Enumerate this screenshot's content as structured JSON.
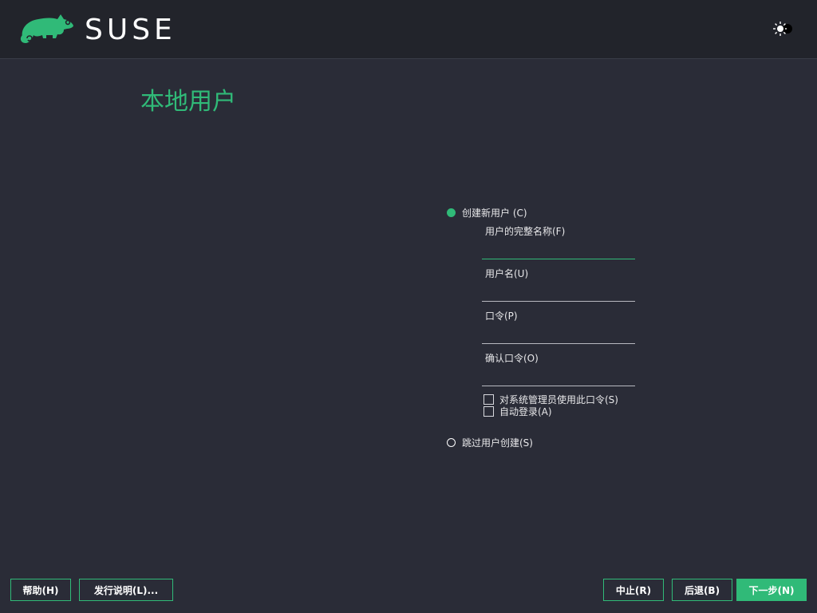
{
  "header": {
    "brand": "SUSE",
    "theme_toggle_icon": "sun-moon-icon"
  },
  "page": {
    "title": "本地用户"
  },
  "form": {
    "create_user": {
      "label": "创建新用户 (C)",
      "checked": true
    },
    "full_name": {
      "label": "用户的完整名称(F)",
      "value": ""
    },
    "username": {
      "label": "用户名(U)",
      "value": ""
    },
    "password": {
      "label": "口令(P)",
      "value": ""
    },
    "confirm_password": {
      "label": "确认口令(O)",
      "value": ""
    },
    "use_for_admin": {
      "label": "对系统管理员使用此口令(S)",
      "checked": false
    },
    "auto_login": {
      "label": "自动登录(A)",
      "checked": false
    },
    "skip_user": {
      "label": "跳过用户创建(S)",
      "checked": false
    }
  },
  "footer": {
    "help": "帮助(H)",
    "release_notes": "发行说明(L)...",
    "abort": "中止(R)",
    "back": "后退(B)",
    "next": "下一步(N)"
  },
  "colors": {
    "accent": "#30ba78",
    "background": "#2a2c37",
    "header": "#22242b"
  }
}
